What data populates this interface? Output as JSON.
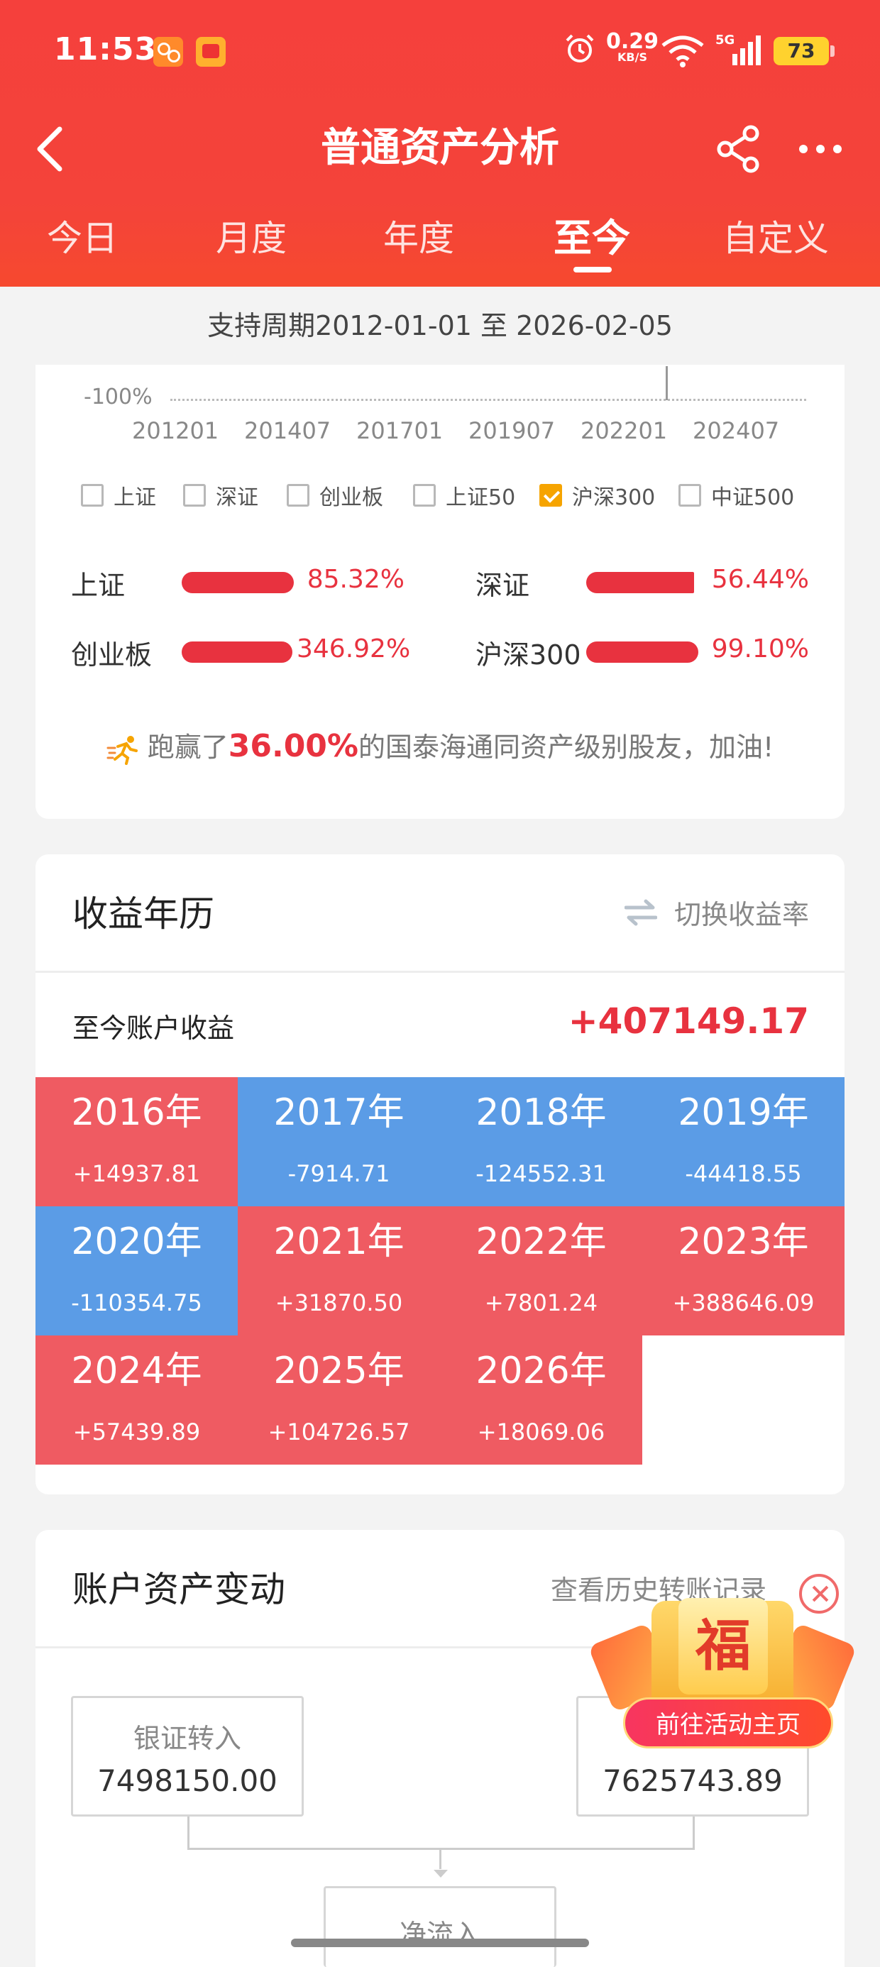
{
  "status_bar": {
    "time": "11:53",
    "net_speed": "0.29",
    "net_unit": "KB/S",
    "network": "5G",
    "battery": "73"
  },
  "nav": {
    "title": "普通资产分析"
  },
  "tabs": [
    {
      "label": "今日",
      "active": false
    },
    {
      "label": "月度",
      "active": false
    },
    {
      "label": "年度",
      "active": false
    },
    {
      "label": "至今",
      "active": true
    },
    {
      "label": "自定义",
      "active": false
    }
  ],
  "period": "支持周期2012-01-01 至 2026-02-05",
  "chart": {
    "y_tick": "-100%",
    "x_ticks": [
      "201201",
      "201407",
      "201701",
      "201907",
      "202201",
      "202407"
    ]
  },
  "legend": [
    {
      "label": "上证",
      "checked": false
    },
    {
      "label": "深证",
      "checked": false
    },
    {
      "label": "创业板",
      "checked": false
    },
    {
      "label": "上证50",
      "checked": false
    },
    {
      "label": "沪深300",
      "checked": true
    },
    {
      "label": "中证500",
      "checked": false
    }
  ],
  "index_compare": [
    {
      "name": "上证",
      "value": "85.32%"
    },
    {
      "name": "深证",
      "value": "56.44%"
    },
    {
      "name": "创业板",
      "value": "346.92%"
    },
    {
      "name": "沪深300",
      "value": "99.10%"
    }
  ],
  "beat": {
    "prefix": "跑赢了",
    "percent": "36.00%",
    "suffix": "的国泰海通同资产级别股友，加油!"
  },
  "calendar": {
    "title": "收益年历",
    "switch_label": "切换收益率",
    "total_label": "至今账户收益",
    "total_value": "+407149.17",
    "years": [
      {
        "year": "2016年",
        "value": "+14937.81",
        "sign": "pos"
      },
      {
        "year": "2017年",
        "value": "-7914.71",
        "sign": "neg"
      },
      {
        "year": "2018年",
        "value": "-124552.31",
        "sign": "neg"
      },
      {
        "year": "2019年",
        "value": "-44418.55",
        "sign": "neg"
      },
      {
        "year": "2020年",
        "value": "-110354.75",
        "sign": "neg"
      },
      {
        "year": "2021年",
        "value": "+31870.50",
        "sign": "pos"
      },
      {
        "year": "2022年",
        "value": "+7801.24",
        "sign": "pos"
      },
      {
        "year": "2023年",
        "value": "+388646.09",
        "sign": "pos"
      },
      {
        "year": "2024年",
        "value": "+57439.89",
        "sign": "pos"
      },
      {
        "year": "2025年",
        "value": "+104726.57",
        "sign": "pos"
      },
      {
        "year": "2026年",
        "value": "+18069.06",
        "sign": "pos"
      }
    ]
  },
  "asset_change": {
    "title": "账户资产变动",
    "history_link": "查看历史转账记录",
    "transfer_in_label": "银证转入",
    "transfer_in_value": "7498150.00",
    "right_value": "7625743.89",
    "net_label": "净流入"
  },
  "promo": {
    "glyph": "福",
    "button_label": "前往活动主页"
  },
  "colors": {
    "brand_red": "#f5403c",
    "profit_red": "#e8323f",
    "gain_cell": "#ef5b62",
    "loss_cell": "#5b9ce6",
    "check_orange": "#f6a400"
  }
}
